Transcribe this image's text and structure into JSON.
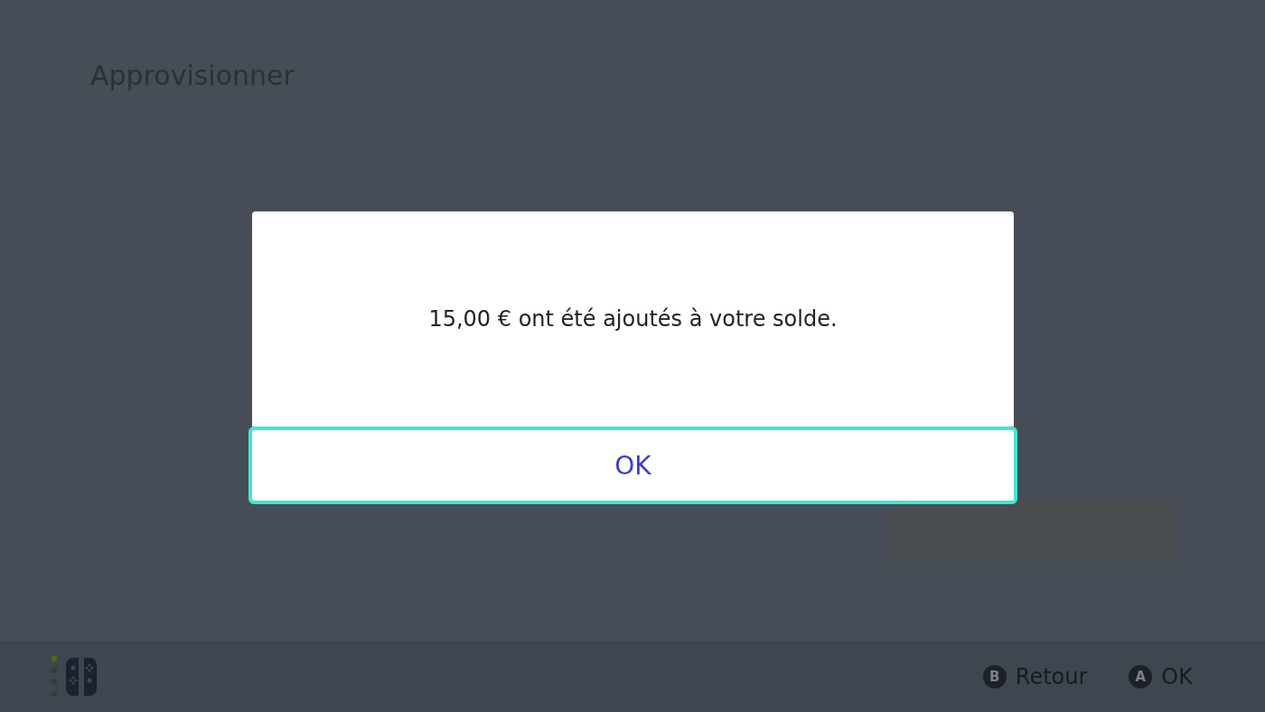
{
  "page": {
    "title": "Approvisionner"
  },
  "dialog": {
    "message": "15,00 € ont été ajoutés à votre solde.",
    "button": {
      "label": "OK",
      "selected": true
    }
  },
  "footer": {
    "hints": [
      {
        "key": "B",
        "label": "Retour"
      },
      {
        "key": "A",
        "label": "OK"
      }
    ]
  }
}
